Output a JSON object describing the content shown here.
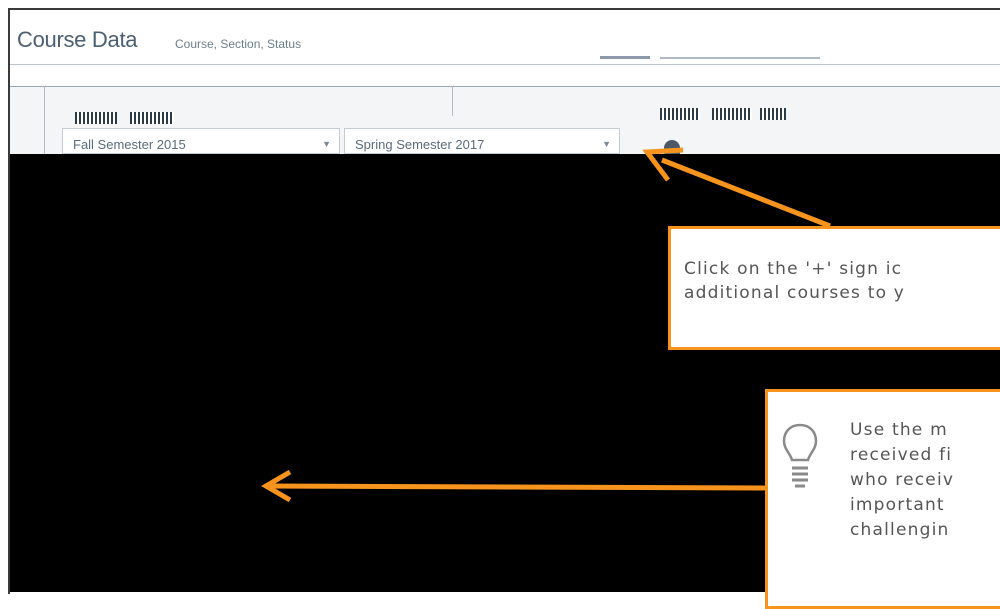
{
  "header": {
    "title": "Course Data",
    "subtitle": "Course, Section, Status"
  },
  "filters": {
    "term_1": "Fall Semester 2015",
    "term_2": "Spring Semester 2017"
  },
  "callouts": {
    "add_course_lines": [
      "Click on the '+' sign ic",
      "additional courses to y"
    ],
    "tip_lines": [
      "Use the m",
      "received fi",
      "who receiv",
      "important",
      "challengin"
    ]
  },
  "colors": {
    "accent": "#f7941d",
    "title": "#4a5f72",
    "overlay": "#000000"
  },
  "icons": {
    "add": "add-icon",
    "tip": "lightbulb-icon"
  }
}
